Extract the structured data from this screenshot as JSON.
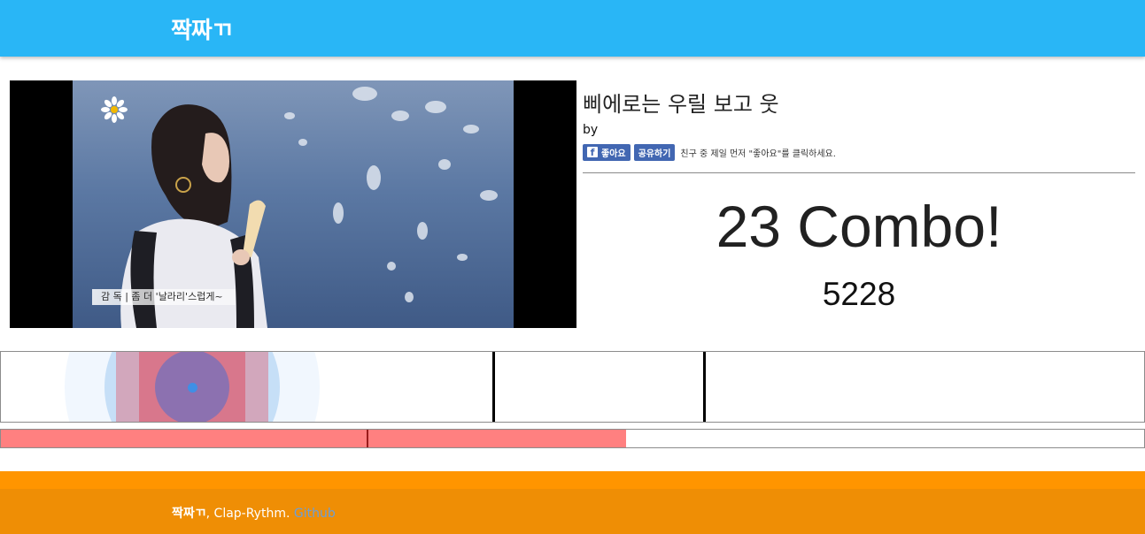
{
  "header": {
    "brand": "짝짜ㄲ"
  },
  "video": {
    "caption": "감 독 | 좀 더 '날라리'스럽게~"
  },
  "song": {
    "title": "삐에로는 우릴 보고 웃",
    "by": "by"
  },
  "facebook": {
    "like_label": "좋아요",
    "share_label": "공유하기",
    "prompt": "친구 중 제일 먼저 \"좋아요\"를 클릭하세요."
  },
  "game": {
    "combo_text": "23 Combo!",
    "score": "5228",
    "progress_fraction": 0.547,
    "progress_marker_fraction": 0.32
  },
  "footer": {
    "brand": "짝짜ㄲ",
    "text": ", Clap-Rythm. ",
    "link": "Github"
  },
  "colors": {
    "appbar": "#29b6f6",
    "footer": "#ef8e05",
    "footer_band": "#ff9500",
    "progress": "#ff8080",
    "facebook": "#4267b2",
    "link": "#6b9fd8"
  }
}
